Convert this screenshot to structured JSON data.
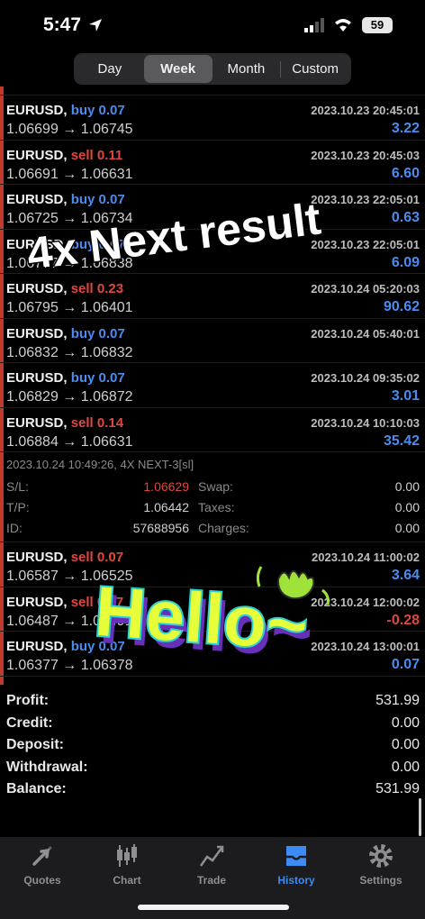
{
  "status": {
    "time": "5:47",
    "battery": "59"
  },
  "periods": {
    "tabs": [
      "Day",
      "Week",
      "Month",
      "Custom"
    ],
    "active": "Week"
  },
  "trades_top": [
    {
      "symbol": "EURUSD,",
      "side": "buy 0.07",
      "side_type": "buy",
      "datetime": "2023.10.23 20:45:01",
      "prices": "1.06699 → 1.06745",
      "profit": "3.22",
      "profit_sign": "pos"
    },
    {
      "symbol": "EURUSD,",
      "side": "sell 0.11",
      "side_type": "sell",
      "datetime": "2023.10.23 20:45:03",
      "prices": "1.06691 → 1.06631",
      "profit": "6.60",
      "profit_sign": "pos"
    },
    {
      "symbol": "EURUSD,",
      "side": "buy 0.07",
      "side_type": "buy",
      "datetime": "2023.10.23 22:05:01",
      "prices": "1.06725 → 1.06734",
      "profit": "0.63",
      "profit_sign": "pos"
    },
    {
      "symbol": "EURUSD,",
      "side": "buy 0.07",
      "side_type": "buy",
      "datetime": "2023.10.23 22:05:01",
      "prices": "1.06777 → 1.06838",
      "profit": "6.09",
      "profit_sign": "pos"
    },
    {
      "symbol": "EURUSD,",
      "side": "sell 0.23",
      "side_type": "sell",
      "datetime": "2023.10.24 05:20:03",
      "prices": "1.06795 → 1.06401",
      "profit": "90.62",
      "profit_sign": "pos"
    },
    {
      "symbol": "EURUSD,",
      "side": "buy 0.07",
      "side_type": "buy",
      "datetime": "2023.10.24 05:40:01",
      "prices": "1.06832 → 1.06832",
      "profit": "",
      "profit_sign": "pos"
    },
    {
      "symbol": "EURUSD,",
      "side": "buy 0.07",
      "side_type": "buy",
      "datetime": "2023.10.24 09:35:02",
      "prices": "1.06829 → 1.06872",
      "profit": "3.01",
      "profit_sign": "pos"
    },
    {
      "symbol": "EURUSD,",
      "side": "sell 0.14",
      "side_type": "sell",
      "datetime": "2023.10.24 10:10:03",
      "prices": "1.06884 → 1.06631",
      "profit": "35.42",
      "profit_sign": "pos"
    }
  ],
  "detail": {
    "header": "2023.10.24 10:49:26, 4X NEXT-3[sl]",
    "sl_label": "S/L:",
    "sl_value": "1.06629",
    "tp_label": "T/P:",
    "tp_value": "1.06442",
    "id_label": "ID:",
    "id_value": "57688956",
    "swap_label": "Swap:",
    "swap_value": "0.00",
    "taxes_label": "Taxes:",
    "taxes_value": "0.00",
    "charges_label": "Charges:",
    "charges_value": "0.00"
  },
  "trades_bottom": [
    {
      "symbol": "EURUSD,",
      "side": "sell 0.07",
      "side_type": "sell",
      "datetime": "2023.10.24 11:00:02",
      "prices": "1.06587 → 1.06525",
      "profit": "3.64",
      "profit_sign": "pos"
    },
    {
      "symbol": "EURUSD,",
      "side": "sell 0.07",
      "side_type": "sell",
      "datetime": "2023.10.24 12:00:02",
      "prices": "1.06487 → 1.06491",
      "profit": "-0.28",
      "profit_sign": "neg"
    },
    {
      "symbol": "EURUSD,",
      "side": "buy 0.07",
      "side_type": "buy",
      "datetime": "2023.10.24 13:00:01",
      "prices": "1.06377 → 1.06378",
      "profit": "0.07",
      "profit_sign": "pos"
    }
  ],
  "summary": [
    {
      "label": "Profit:",
      "value": "531.99"
    },
    {
      "label": "Credit:",
      "value": "0.00"
    },
    {
      "label": "Deposit:",
      "value": "0.00"
    },
    {
      "label": "Withdrawal:",
      "value": "0.00"
    },
    {
      "label": "Balance:",
      "value": "531.99"
    }
  ],
  "overlays": {
    "banner": "4x Next result",
    "sticker": "Hello~"
  },
  "tabbar": {
    "items": [
      "Quotes",
      "Chart",
      "Trade",
      "History",
      "Settings"
    ],
    "active": "History"
  },
  "colors": {
    "buy": "#4a8cf0",
    "sell": "#e0473f",
    "accent": "#3d8bf5"
  }
}
